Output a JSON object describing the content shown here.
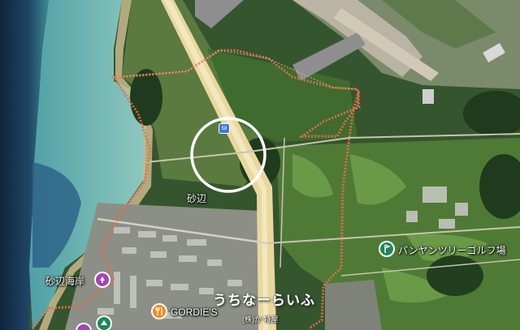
{
  "map": {
    "labels": {
      "area": "砂辺",
      "beach": "砂辺海岸",
      "golf": "パンヤンツリーゴルフ場",
      "restaurant": "GORDIE'S",
      "route_shield": "58"
    },
    "watermark": {
      "title": "うちなーらいふ",
      "subtitle": "(株)か 特屋"
    },
    "icons": {
      "beach_pin": "park-pin-icon",
      "golf_pin": "golf-pin-icon",
      "restaurant_pin": "restaurant-pin-icon"
    },
    "colors": {
      "ocean": "#1d3d5c",
      "reef": "#6fb6b6",
      "boundary": "#e0704a",
      "highlight_circle": "#ffffff",
      "pin_purple": "#a445b2",
      "pin_green": "#22865a",
      "pin_orange": "#f08a24"
    }
  }
}
